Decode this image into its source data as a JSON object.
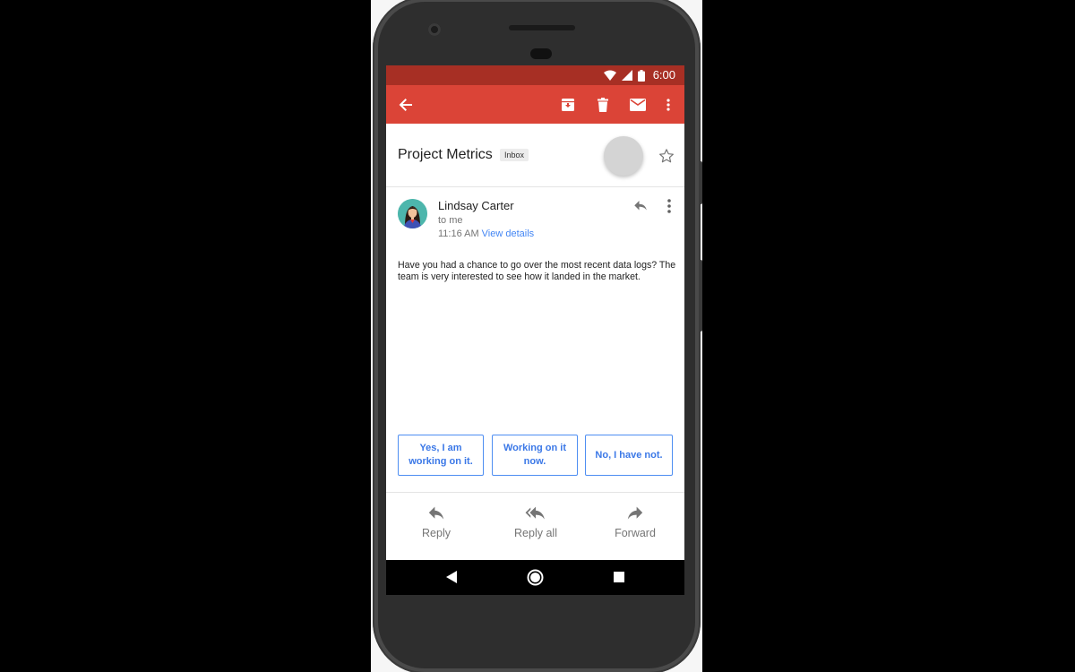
{
  "status_bar": {
    "time": "6:00",
    "icons": [
      "wifi-icon",
      "cellular-signal-icon",
      "battery-icon"
    ]
  },
  "app_bar": {
    "icons": [
      "back-arrow-icon",
      "archive-icon",
      "delete-icon",
      "mark-unread-icon",
      "more-vert-icon"
    ],
    "color": "#db4437",
    "status_color": "#a72f24"
  },
  "email": {
    "subject": "Project Metrics",
    "label": "Inbox",
    "sender": "Lindsay Carter",
    "recipient": "to me",
    "time": "11:16 AM",
    "view_details": "View details",
    "body": "Have you had a chance to go over the most recent data logs? The team is very interested to see how it landed in the market."
  },
  "smart_replies": [
    "Yes, I am working on it.",
    "Working on it now.",
    "No, I have not."
  ],
  "actions": [
    {
      "label": "Reply",
      "icon": "reply-icon"
    },
    {
      "label": "Reply all",
      "icon": "reply-all-icon"
    },
    {
      "label": "Forward",
      "icon": "forward-icon"
    }
  ],
  "nav": [
    "back-triangle-icon",
    "home-circle-icon",
    "recents-square-icon"
  ],
  "colors": {
    "link": "#4285f4",
    "smart_reply_border": "#4e8ef2"
  }
}
